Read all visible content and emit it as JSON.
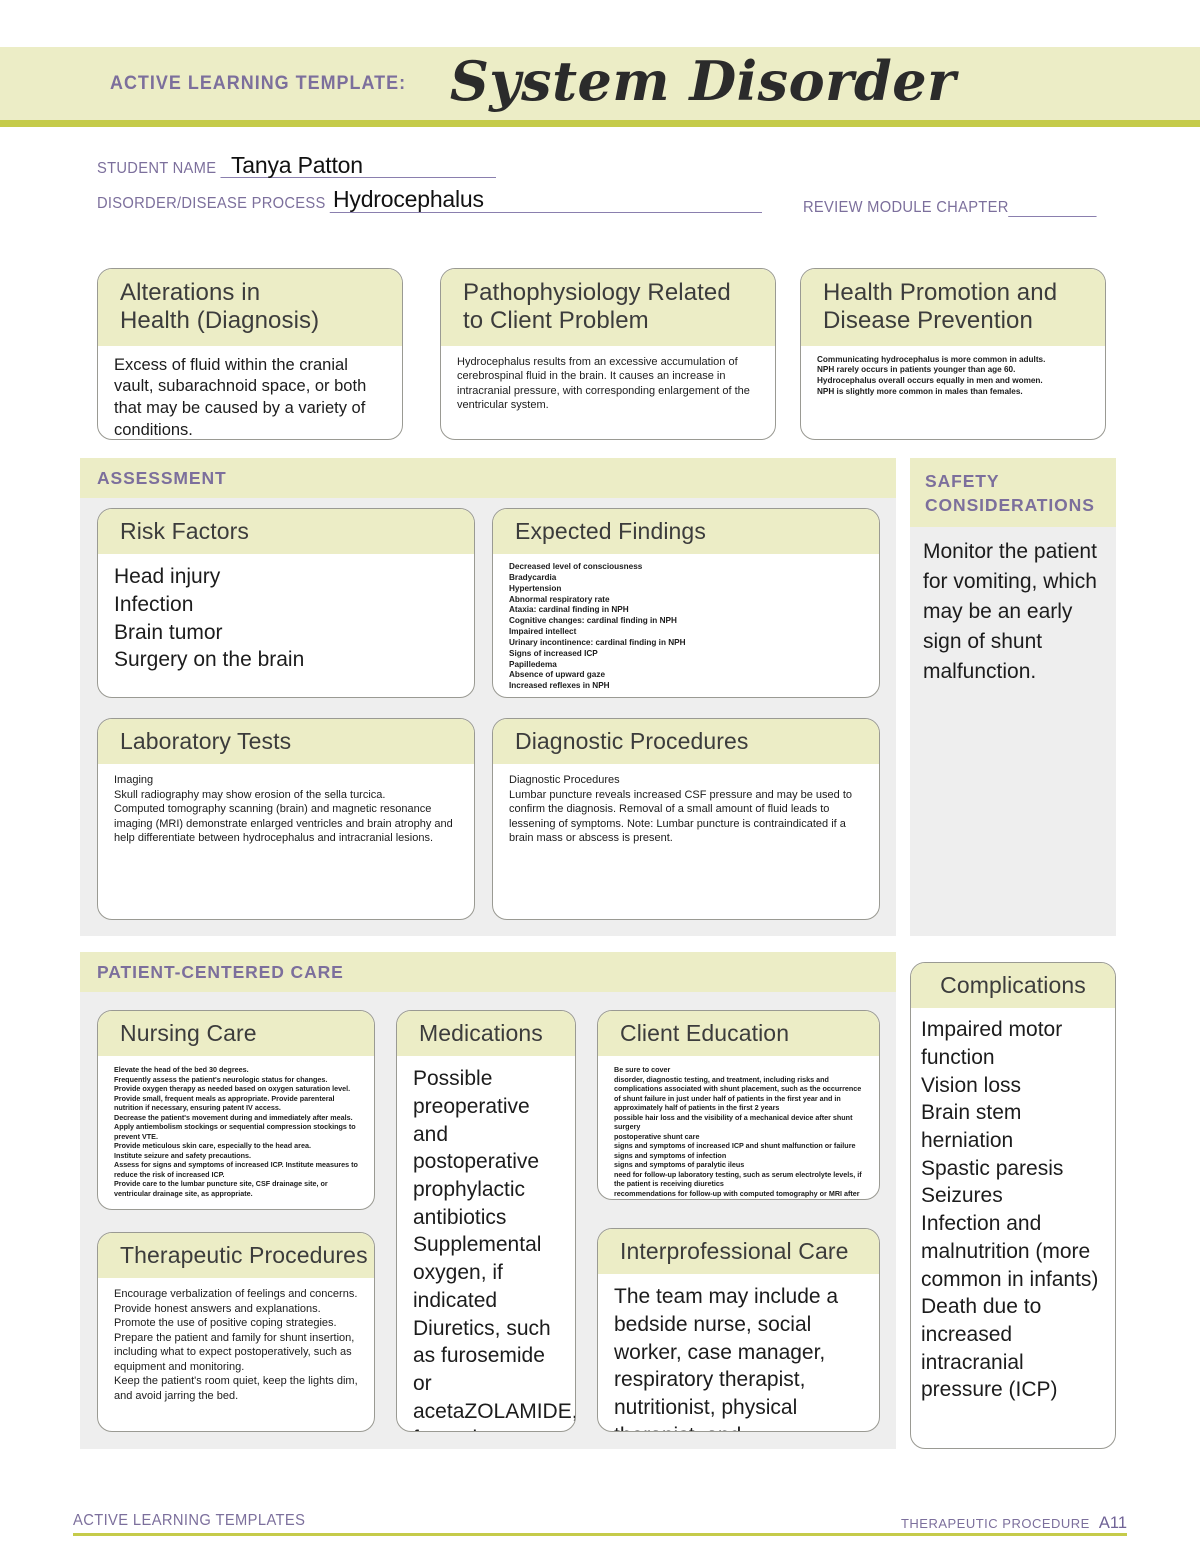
{
  "header": {
    "kicker": "ACTIVE LEARNING TEMPLATE:",
    "title": "System Disorder"
  },
  "form": {
    "student_name_label": "STUDENT NAME",
    "student_name_value": "Tanya Patton",
    "disorder_label": "DISORDER/DISEASE PROCESS",
    "disorder_value": "Hydrocephalus",
    "review_module_label": "REVIEW MODULE CHAPTER",
    "review_module_value": ""
  },
  "top_boxes": {
    "alterations": {
      "title": "Alterations in\nHealth (Diagnosis)",
      "title_line1": "Alterations in",
      "title_line2": "Health (Diagnosis)",
      "body": "Excess of fluid within the cranial vault, subarachnoid space, or both that may be caused by a variety of conditions."
    },
    "pathophysiology": {
      "title_line1": "Pathophysiology Related",
      "title_line2": "to Client Problem",
      "body": "Hydrocephalus results from an excessive accumulation of cerebrospinal fluid in the brain. It causes an increase in intracranial pressure, with corresponding enlargement of the ventricular system."
    },
    "health_promotion": {
      "title_line1": "Health Promotion and",
      "title_line2": "Disease Prevention",
      "lines": [
        "Communicating hydrocephalus is more common in adults.",
        "NPH rarely occurs in patients younger than age 60.",
        "Hydrocephalus overall occurs equally in men and women.",
        "NPH is slightly more common in males than females."
      ]
    }
  },
  "assessment": {
    "section_title": "ASSESSMENT",
    "risk_factors": {
      "title": "Risk Factors",
      "items": [
        "Head injury",
        "Infection",
        "Brain tumor",
        "Surgery on the brain"
      ]
    },
    "expected_findings": {
      "title": "Expected Findings",
      "items": [
        "Decreased level of consciousness",
        "Bradycardia",
        "Hypertension",
        "Abnormal respiratory rate",
        "Ataxia: cardinal finding in NPH",
        "Cognitive changes: cardinal finding in NPH",
        "Impaired intellect",
        "Urinary incontinence: cardinal finding in NPH",
        "Signs of increased ICP",
        "Papilledema",
        "Absence of upward gaze",
        "Increased reflexes in NPH"
      ]
    },
    "laboratory_tests": {
      "title": "Laboratory Tests",
      "lines": [
        "Imaging",
        "Skull radiography may show erosion of the sella turcica.",
        "Computed tomography scanning (brain) and magnetic resonance imaging (MRI) demonstrate enlarged ventricles and brain atrophy and help differentiate between hydrocephalus and intracranial lesions."
      ]
    },
    "diagnostic_procedures": {
      "title": "Diagnostic Procedures",
      "lines": [
        "Diagnostic Procedures",
        "Lumbar puncture reveals increased CSF pressure and may be used to confirm the diagnosis. Removal of a small amount of fluid leads to lessening of symptoms. Note: Lumbar puncture is contraindicated if a brain mass or abscess is present."
      ]
    }
  },
  "safety": {
    "section_title_line1": "SAFETY",
    "section_title_line2": "CONSIDERATIONS",
    "body": "Monitor the patient for vomiting, which may be an early sign of shunt malfunction."
  },
  "patient_centered_care": {
    "section_title": "PATIENT-CENTERED CARE",
    "nursing_care": {
      "title": "Nursing Care",
      "lines": [
        "Elevate the head of the bed 30 degrees.",
        "Frequently assess the patient's neurologic status for changes.",
        "Provide oxygen therapy as needed based on oxygen saturation level.",
        "Provide small, frequent meals as appropriate. Provide parenteral nutrition if necessary, ensuring patent IV access.",
        "Decrease the patient's movement during and immediately after meals.",
        "Apply antiembolism stockings or sequential compression stockings to prevent VTE.",
        "Provide meticulous skin care, especially to the head area.",
        "Institute seizure and safety precautions.",
        "Assess for signs and symptoms of increased ICP. Institute measures to reduce the risk of increased ICP.",
        "Provide care to the lumbar puncture site, CSF drainage site, or ventricular drainage site, as appropriate."
      ]
    },
    "medications": {
      "title": "Medications",
      "body": "Possible preoperative and postoperative prophylactic antibiotics Supplemental oxygen, if indicated Diuretics, such as furosemide or acetaZOLAMIDE, for patients too unstable for surgery"
    },
    "client_education": {
      "title": "Client Education",
      "lines": [
        "Be sure to cover",
        "disorder, diagnostic testing, and treatment, including risks and complications associated with shunt placement, such as the occurrence of shunt failure in just under half of patients in the first year and in approximately half of patients in the first 2 years",
        "possible hair loss and the visibility of a mechanical device after shunt surgery",
        "postoperative shunt care",
        "signs and symptoms of increased ICP and shunt malfunction or failure",
        "signs and symptoms of infection",
        "signs and symptoms of paralytic ileus",
        "need for follow-up laboratory testing, such as serum electrolyte levels, if the patient is receiving diuretics",
        "recommendations for follow-up with computed tomography or MRI after shunt placement, usually 3 months after surgery, then every 6 to 12 months for the first 2 years, and then every 2 years thereafter"
      ]
    },
    "therapeutic_procedures": {
      "title": "Therapeutic Procedures",
      "lines": [
        "Encourage verbalization of feelings and concerns.",
        "Provide honest answers and explanations. Promote the use of positive coping strategies.",
        "Prepare the patient and family for shunt insertion, including what to expect postoperatively, such as equipment and monitoring.",
        "Keep the patient's room quiet, keep the lights dim, and avoid jarring the bed."
      ]
    },
    "interprofessional_care": {
      "title": "Interprofessional Care",
      "body": "The team may include a bedside nurse, social worker, case manager, respiratory therapist, nutritionist, physical therapist, and neurosurgeon."
    }
  },
  "complications": {
    "title": "Complications",
    "items": [
      "Impaired motor function",
      "Vision loss",
      "Brain stem herniation",
      "Spastic paresis",
      "Seizures",
      "Infection and malnutrition (more common in infants)",
      "Death due to increased intracranial pressure (ICP)"
    ]
  },
  "footer": {
    "left": "ACTIVE LEARNING TEMPLATES",
    "right": "THERAPEUTIC PROCEDURE",
    "page": "A11"
  },
  "colors": {
    "band": "#ecedc6",
    "rule": "#c5cb4a",
    "accent_purple": "#7c6f9c",
    "panel_gray": "#eeeeee"
  }
}
